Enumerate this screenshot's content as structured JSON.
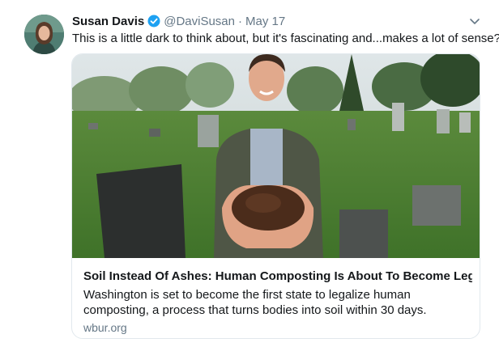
{
  "tweet": {
    "author_name": "Susan Davis",
    "handle": "@DaviSusan",
    "separator": "·",
    "date": "May 17",
    "text": "This is a little dark to think about, but it's fascinating and...makes a lot of sense?",
    "verified_icon": "verified-badge-icon",
    "menu_icon": "chevron-down-icon"
  },
  "card": {
    "title": "Soil Instead Of Ashes: Human Composting Is About To Become Legal...",
    "description": "Washington is set to become the first state to legalize human composting, a process that turns bodies into soil within 30 days.",
    "domain": "wbur.org"
  },
  "colors": {
    "verified": "#1da1f2",
    "secondary_text": "#657786",
    "border": "#e1e8ed"
  }
}
